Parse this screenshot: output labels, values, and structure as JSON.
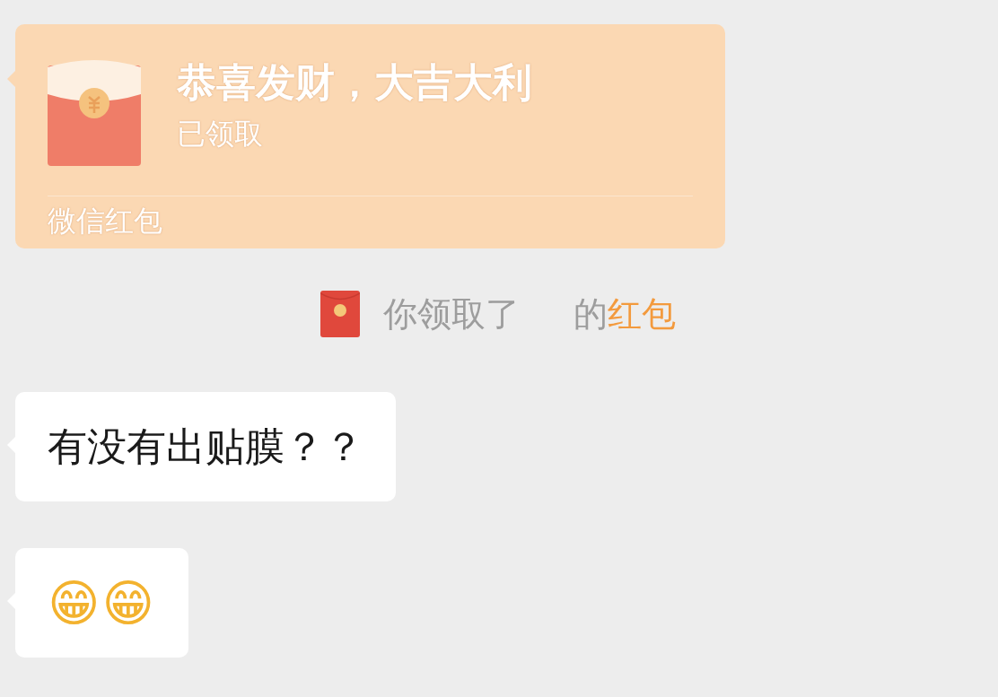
{
  "red_packet": {
    "title": "恭喜发财，大吉大利",
    "status": "已领取",
    "footer": "微信红包"
  },
  "notice": {
    "before": "你领取了",
    "after": "的",
    "link": "红包"
  },
  "messages": [
    {
      "kind": "text",
      "text": "有没有出贴膜？？"
    },
    {
      "kind": "emoji",
      "text": "😁😁"
    }
  ]
}
